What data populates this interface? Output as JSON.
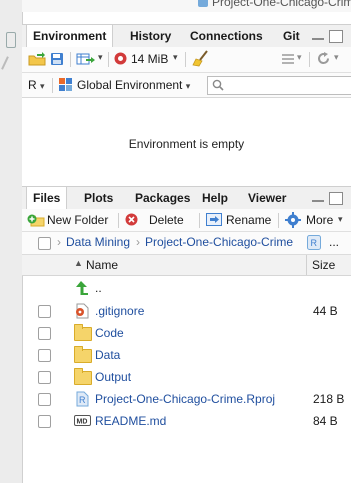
{
  "window": {
    "project_title": "Project-One-Chicago-Crime"
  },
  "env_pane": {
    "tabs": [
      "Environment",
      "History",
      "Connections",
      "Git"
    ],
    "active_tab": "Environment",
    "memory_label": "14 MiB",
    "lang_label": "R",
    "scope_label": "Global Environment",
    "search_placeholder": "",
    "empty_message": "Environment is empty"
  },
  "files_pane": {
    "tabs": [
      "Files",
      "Plots",
      "Packages",
      "Help",
      "Viewer"
    ],
    "active_tab": "Files",
    "toolbar": {
      "new_folder": "New Folder",
      "delete": "Delete",
      "rename": "Rename",
      "more": "More"
    },
    "breadcrumb": [
      "Data Mining",
      "Project-One-Chicago-Crime"
    ],
    "breadcrumb_more": "...",
    "columns": {
      "name": "Name",
      "size": "Size"
    },
    "parent_label": "..",
    "files": [
      {
        "name": ".gitignore",
        "size": "44 B",
        "icon": "gitignore-icon"
      },
      {
        "name": "Code",
        "size": "",
        "icon": "folder-icon"
      },
      {
        "name": "Data",
        "size": "",
        "icon": "folder-icon"
      },
      {
        "name": "Output",
        "size": "",
        "icon": "folder-icon"
      },
      {
        "name": "Project-One-Chicago-Crime.Rproj",
        "size": "218 B",
        "icon": "rproj-icon"
      },
      {
        "name": "README.md",
        "size": "84 B",
        "icon": "markdown-icon"
      }
    ]
  },
  "colors": {
    "link": "#1f4e9e",
    "folder": "#f5d46a",
    "accent_green": "#3aa53a",
    "accent_red": "#d23b3b"
  }
}
